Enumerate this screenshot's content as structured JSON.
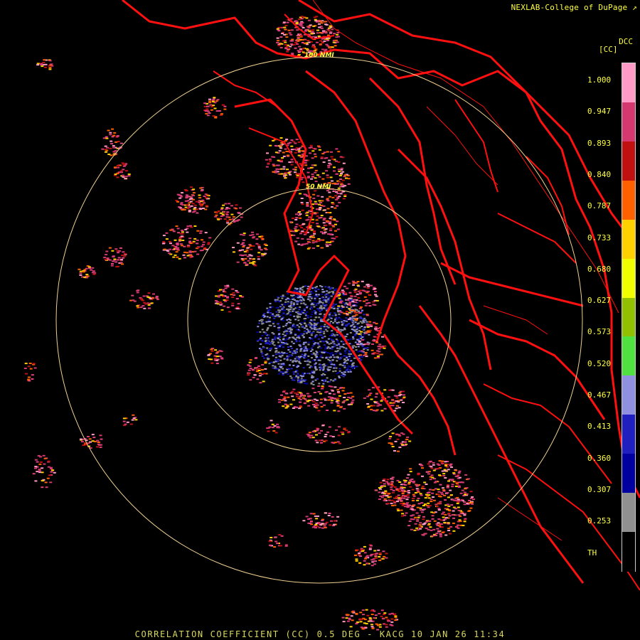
{
  "header": {
    "credit": "NEXLAB-College of DuPage ↗"
  },
  "footer": {
    "caption": "CORRELATION COEFFICIENT (CC) 0.5 DEG - KACG 10 JAN 26 11:34"
  },
  "legend": {
    "product_code": "DCC",
    "unit": "[CC]",
    "ticks": [
      "1.000",
      "0.947",
      "0.893",
      "0.840",
      "0.787",
      "0.733",
      "0.680",
      "0.627",
      "0.573",
      "0.520",
      "0.467",
      "0.413",
      "0.360",
      "0.307",
      "0.253",
      "TH"
    ],
    "colors": [
      "#ff9bc6",
      "#d4386e",
      "#c01010",
      "#ff6000",
      "#ffd000",
      "#f0ff00",
      "#90c000",
      "#50e040",
      "#9090e0",
      "#2020c0",
      "#0000a0",
      "#909090",
      "#000000"
    ]
  },
  "rings": {
    "inner_label": "50 NMI",
    "outer_label": "100 NMI"
  },
  "colors": {
    "background": "#000000",
    "coast": "#ff1010",
    "range_ring": "#f0d090",
    "text": "#ffff40"
  }
}
